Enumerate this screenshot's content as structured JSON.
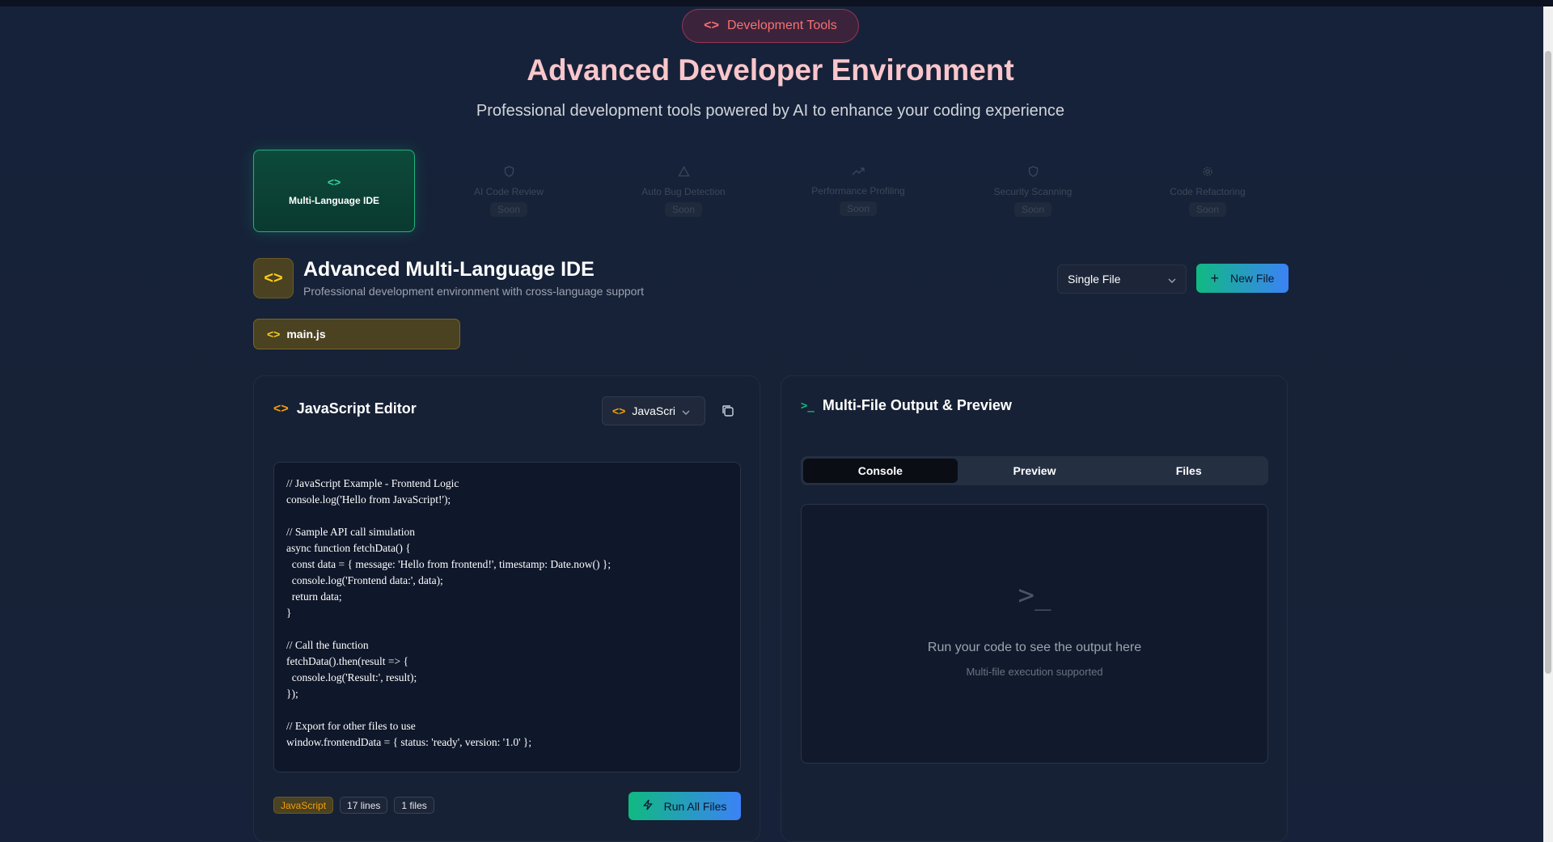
{
  "header": {
    "badge_icon": "code-icon",
    "badge_label": "Development Tools",
    "title": "Advanced Developer Environment",
    "subtitle": "Professional development tools powered by AI to enhance your coding experience"
  },
  "tools": [
    {
      "label": "Multi-Language IDE",
      "icon": "code-icon",
      "status": "",
      "active": true
    },
    {
      "label": "AI Code Review",
      "icon": "shield-icon",
      "status": "Soon",
      "active": false
    },
    {
      "label": "Auto Bug Detection",
      "icon": "warning-icon",
      "status": "Soon",
      "active": false
    },
    {
      "label": "Performance Profiling",
      "icon": "trending-up-icon",
      "status": "Soon",
      "active": false
    },
    {
      "label": "Security Scanning",
      "icon": "shield-icon",
      "status": "Soon",
      "active": false
    },
    {
      "label": "Code Refactoring",
      "icon": "gear-icon",
      "status": "Soon",
      "active": false
    }
  ],
  "ide": {
    "title": "Advanced Multi-Language IDE",
    "subtitle": "Professional development environment with cross-language support",
    "mode_select": "Single File",
    "new_file_label": "New File",
    "open_file": "main.js"
  },
  "editor": {
    "title": "JavaScript Editor",
    "language_select": "JavaScript",
    "code": "// JavaScript Example - Frontend Logic\nconsole.log('Hello from JavaScript!');\n\n// Sample API call simulation\nasync function fetchData() {\n  const data = { message: 'Hello from frontend!', timestamp: Date.now() };\n  console.log('Frontend data:', data);\n  return data;\n}\n\n// Call the function\nfetchData().then(result => {\n  console.log('Result:', result);\n});\n\n// Export for other files to use\nwindow.frontendData = { status: 'ready', version: '1.0' };",
    "badge_language": "JavaScript",
    "badge_lines": "17 lines",
    "badge_files": "1 files",
    "run_label": "Run All Files"
  },
  "output": {
    "title": "Multi-File Output & Preview",
    "tabs": [
      "Console",
      "Preview",
      "Files"
    ],
    "active_tab": "Console",
    "empty_icon": ">_",
    "empty_message": "Run your code to see the output here",
    "empty_sub": "Multi-file execution supported"
  },
  "colors": {
    "accent_green": "#10b981",
    "accent_blue": "#3b82f6",
    "accent_yellow": "#facc15",
    "badge_red": "#f87171"
  }
}
